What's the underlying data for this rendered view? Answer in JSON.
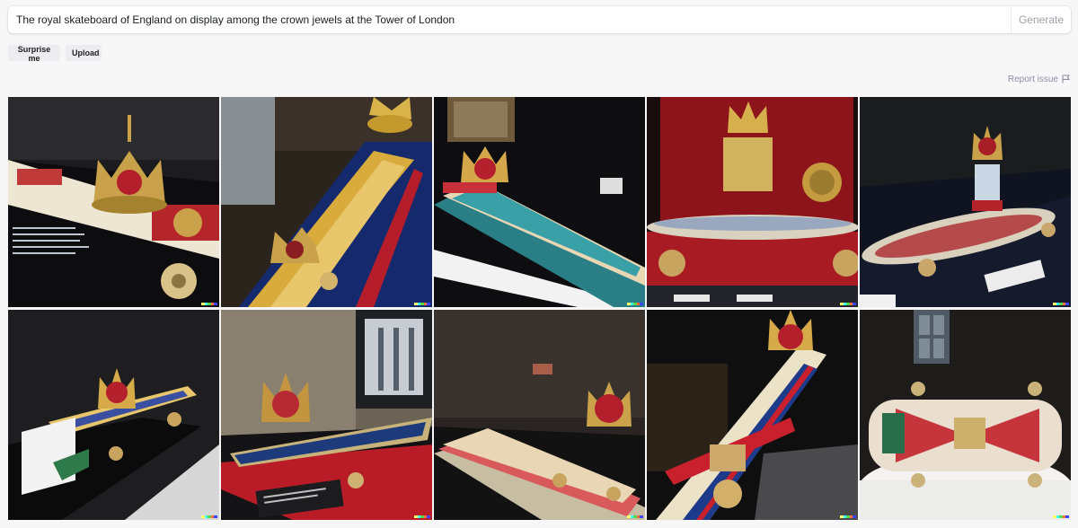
{
  "prompt": {
    "value": "The royal skateboard of England on display among the crown jewels at the Tower of London",
    "generate_label": "Generate"
  },
  "actions": {
    "surprise_label": "Surprise me",
    "upload_label": "Upload"
  },
  "report": {
    "label": "Report issue",
    "icon": "flag-icon"
  },
  "images": [
    {
      "name": "crown-skateboard-case-1"
    },
    {
      "name": "gold-skateboard-blue-2"
    },
    {
      "name": "mosaic-skateboard-3"
    },
    {
      "name": "skateboard-red-backdrop-4"
    },
    {
      "name": "skateboard-glass-case-5"
    },
    {
      "name": "skateboard-plinth-6"
    },
    {
      "name": "skateboard-stone-wall-7"
    },
    {
      "name": "skateboard-red-table-8"
    },
    {
      "name": "union-jack-skateboard-9"
    },
    {
      "name": "skateboard-white-plinth-10"
    }
  ],
  "colors": {
    "accent_generate_text": "#a2a2ab",
    "signature": [
      "#ffff66",
      "#42ffff",
      "#51da4c",
      "#ff6e3c",
      "#3c46ff"
    ]
  }
}
